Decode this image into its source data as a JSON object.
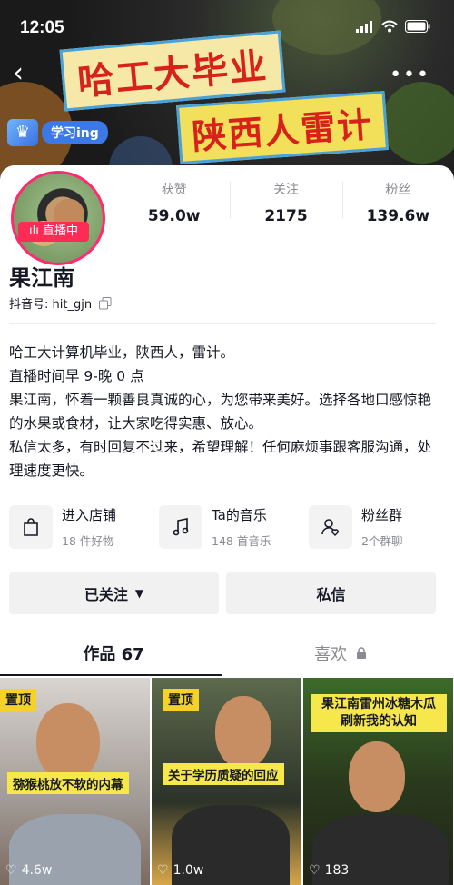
{
  "status_bar": {
    "time": "12:05"
  },
  "banner": {
    "line1": "哈工大毕业",
    "line2": "陕西人雷计"
  },
  "profile": {
    "badge": "学习ing",
    "live_label": "直播中",
    "name": "果江南",
    "douyin_id": "抖音号: hit_gjn",
    "stats": [
      {
        "label": "获赞",
        "value": "59.0w"
      },
      {
        "label": "关注",
        "value": "2175"
      },
      {
        "label": "粉丝",
        "value": "139.6w"
      }
    ],
    "bio": [
      "哈工大计算机毕业，陕西人，雷计。",
      "直播时间早 9-晚 0 点",
      "果江南，怀着一颗善良真诚的心，为您带来美好。选择各地口感惊艳的水果或食材，让大家吃得实惠、放心。",
      "私信太多，有时回复不过来，希望理解！任何麻烦事跟客服沟通，处理速度更快。"
    ]
  },
  "features": [
    {
      "title": "进入店铺",
      "sub": "18 件好物",
      "icon": "shopping-bag-icon"
    },
    {
      "title": "Ta的音乐",
      "sub": "148 首音乐",
      "icon": "music-note-icon"
    },
    {
      "title": "粉丝群",
      "sub": "2个群聊",
      "icon": "fans-group-icon"
    }
  ],
  "buttons": {
    "follow": "已关注",
    "message": "私信"
  },
  "tabs": {
    "works": "作品 67",
    "likes": "喜欢"
  },
  "videos": [
    {
      "pinned": "置顶",
      "caption": "猕猴桃放不软的内幕",
      "likes": "4.6w"
    },
    {
      "pinned": "置顶",
      "caption": "关于学历质疑的回应",
      "likes": "1.0w"
    },
    {
      "caption": "果江南雷州冰糖木瓜 刷新我的认知",
      "caption_l1": "果江南雷州冰糖木瓜",
      "caption_l2": "刷新我的认知",
      "likes": "183"
    }
  ],
  "colors": {
    "accent": "#fe2c55",
    "pin": "#f6d128",
    "badge": "#3a79e6"
  }
}
